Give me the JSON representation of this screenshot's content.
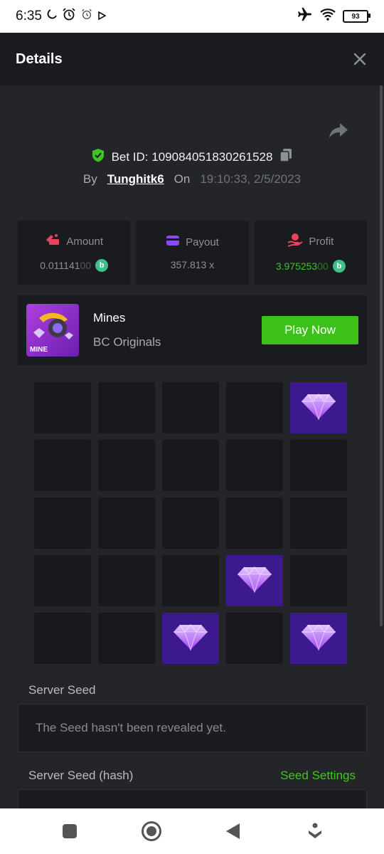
{
  "status_bar": {
    "time": "6:35",
    "battery": "93"
  },
  "header": {
    "title": "Details"
  },
  "bet": {
    "id_label": "Bet ID: 109084051830261528",
    "by_label": "By",
    "username": "Tunghitk6",
    "on_label": "On",
    "datetime": "19:10:33, 2/5/2023"
  },
  "stats": {
    "amount": {
      "label": "Amount",
      "value_main": "0.011141",
      "value_dim": "00"
    },
    "payout": {
      "label": "Payout",
      "value": "357.813 x"
    },
    "profit": {
      "label": "Profit",
      "value_main": "3.975253",
      "value_dim": "00"
    }
  },
  "game": {
    "name": "Mines",
    "provider": "BC Originals",
    "thumb_text": "MINE",
    "play_label": "Play Now"
  },
  "board": {
    "rows": 5,
    "cols": 5,
    "gems": [
      4,
      18,
      22,
      24
    ]
  },
  "server_seed": {
    "label": "Server Seed",
    "value": "The Seed hasn't been revealed yet."
  },
  "server_seed_hash": {
    "label": "Server Seed (hash)",
    "settings_label": "Seed Settings"
  },
  "colors": {
    "accent_green": "#3bc117",
    "gem_tile": "#3d1990",
    "coin": "#3fbf8c"
  }
}
